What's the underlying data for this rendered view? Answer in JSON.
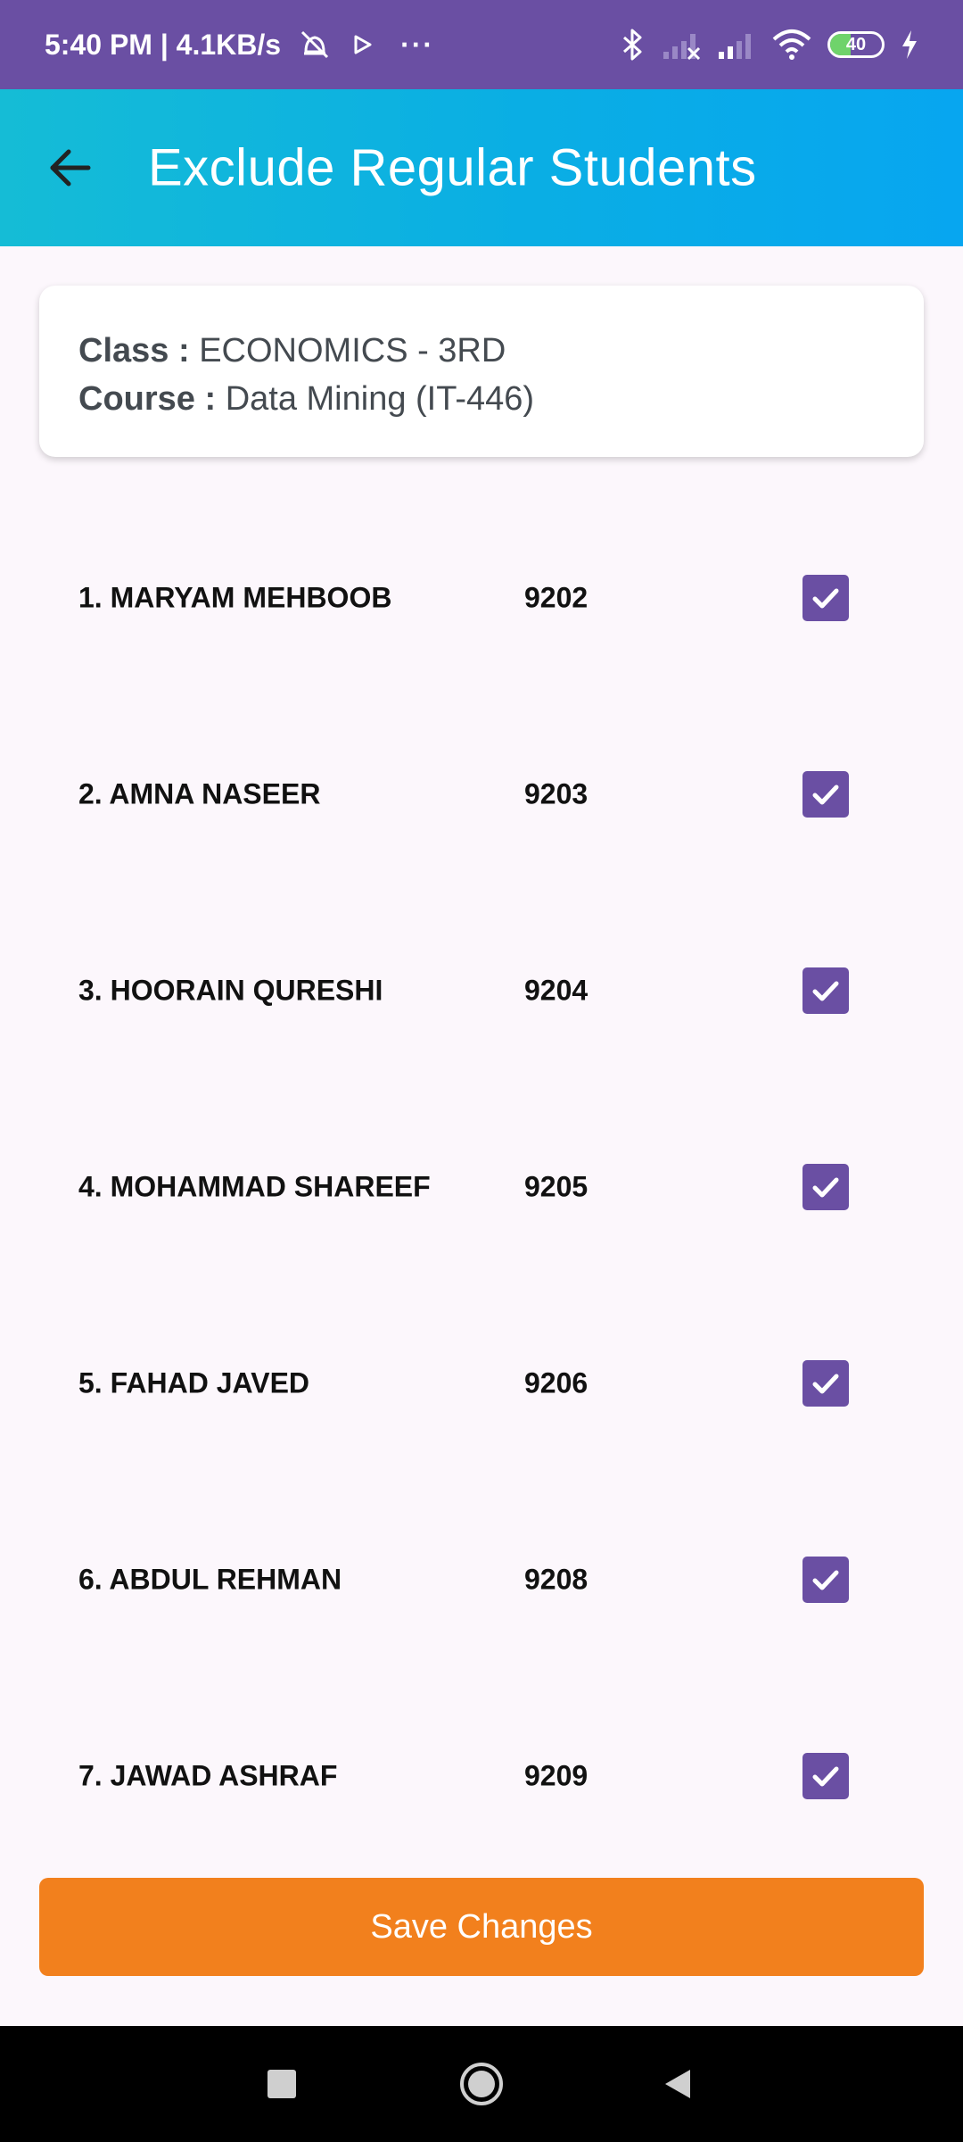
{
  "status_bar": {
    "time_speed": "5:40 PM | 4.1KB/s",
    "more": "···",
    "battery_level": "40",
    "battery_fraction": 0.4,
    "icons": [
      "alarm-off-icon",
      "play-icon",
      "bluetooth-icon",
      "signal-icon",
      "wifi-icon",
      "battery-icon",
      "charging-icon"
    ]
  },
  "app_bar": {
    "title": "Exclude Regular Students",
    "back_icon": "arrow-left-icon"
  },
  "info": {
    "class_label": "Class :",
    "class_value": "ECONOMICS - 3RD",
    "course_label": "Course :",
    "course_value": "Data Mining (IT-446)"
  },
  "students": [
    {
      "name": "1. MARYAM MEHBOOB",
      "roll": "9202",
      "checked": true
    },
    {
      "name": "2. AMNA NASEER",
      "roll": "9203",
      "checked": true
    },
    {
      "name": "3. HOORAIN QURESHI",
      "roll": "9204",
      "checked": true
    },
    {
      "name": "4. MOHAMMAD SHAREEF",
      "roll": "9205",
      "checked": true
    },
    {
      "name": "5. FAHAD JAVED",
      "roll": "9206",
      "checked": true
    },
    {
      "name": "6. ABDUL REHMAN",
      "roll": "9208",
      "checked": true
    },
    {
      "name": "7. JAWAD ASHRAF",
      "roll": "9209",
      "checked": true
    }
  ],
  "save_button": {
    "label": "Save Changes"
  },
  "colors": {
    "status_bar": "#6a4fa3",
    "accent": "#6a4fa3",
    "app_bar_start": "#15bcd6",
    "app_bar_end": "#07a6f0",
    "save_button": "#f2801d",
    "background": "#fcf7fc"
  },
  "nav_bar": {
    "icons": [
      "recents-square-icon",
      "home-circle-icon",
      "back-triangle-icon"
    ]
  }
}
